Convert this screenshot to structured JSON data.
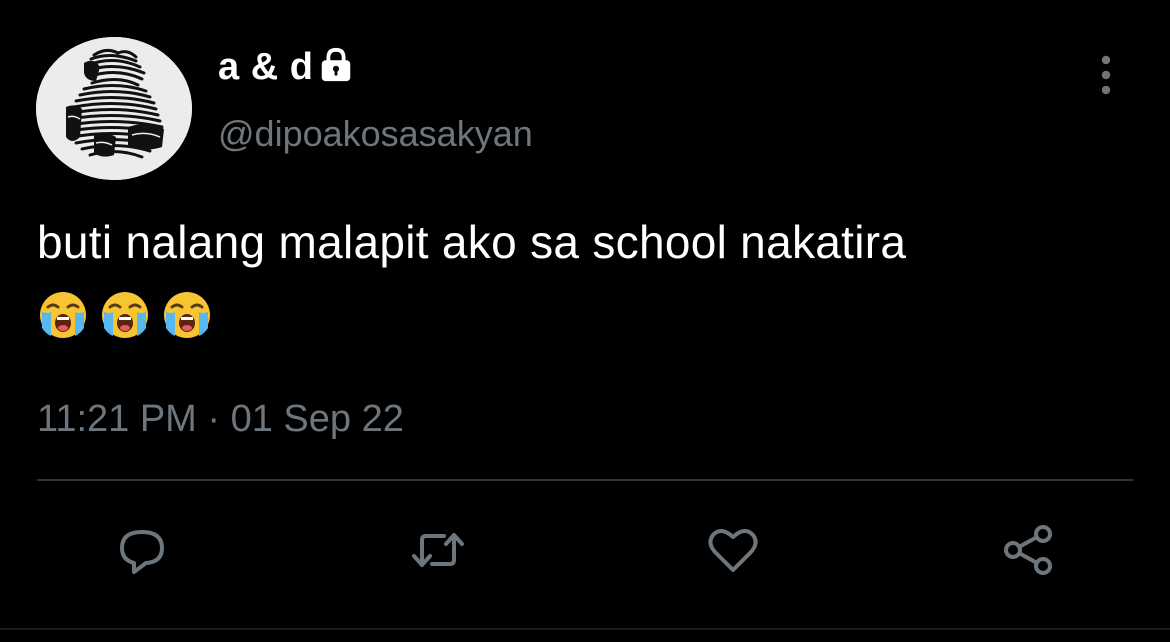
{
  "tweet": {
    "display_name": "a & d",
    "handle": "@dipoakosasakyan",
    "text": "buti nalang malapit ako sa school nakatira",
    "emojis": [
      "loudly-crying-face",
      "loudly-crying-face",
      "loudly-crying-face"
    ],
    "timestamp": "11:21 PM · 01 Sep 22",
    "protected": true
  },
  "icons": {
    "lock": "lock-icon",
    "more": "more-vertical-icon",
    "reply": "reply-icon",
    "retweet": "retweet-icon",
    "like": "heart-icon",
    "share": "share-icon"
  },
  "colors": {
    "background": "#000000",
    "text_primary": "#ffffff",
    "text_secondary": "#6e767d",
    "divider": "#2f3336",
    "avatar_bg": "#ededed"
  }
}
